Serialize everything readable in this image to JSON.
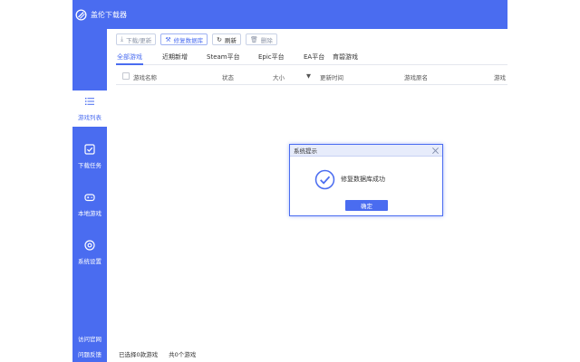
{
  "app": {
    "title": "盖伦下载器"
  },
  "sidebar": {
    "items": [
      {
        "label": "游戏列表",
        "icon": "list-icon",
        "active": true
      },
      {
        "label": "下载任务",
        "icon": "checkbox-icon",
        "active": false
      },
      {
        "label": "本地游戏",
        "icon": "gamepad-icon",
        "active": false
      },
      {
        "label": "系统设置",
        "icon": "settings-icon",
        "active": false
      }
    ],
    "bottom_links": [
      "访问官网",
      "问题反馈"
    ]
  },
  "toolbar": {
    "download_label": "下载/更新",
    "repair_label": "修复数据库",
    "refresh_label": "刷新",
    "delete_label": "删除"
  },
  "tabs": [
    "全部游戏",
    "近期新增",
    "Steam平台",
    "Epic平台",
    "EA平台",
    "育碧游戏"
  ],
  "table": {
    "columns": [
      "游戏名称",
      "状态",
      "大小",
      "更新时间",
      "游戏原名",
      "游戏"
    ],
    "sort_indicator": "▼",
    "rows": []
  },
  "footer": {
    "selected": "已选择0款游戏",
    "total": "共0个游戏"
  },
  "dialog": {
    "title": "系统提示",
    "message": "修复数据库成功",
    "confirm_label": "确定"
  },
  "colors": {
    "accent": "#4a6cf0",
    "background": "#ffffff",
    "border": "#e4e7ee"
  }
}
